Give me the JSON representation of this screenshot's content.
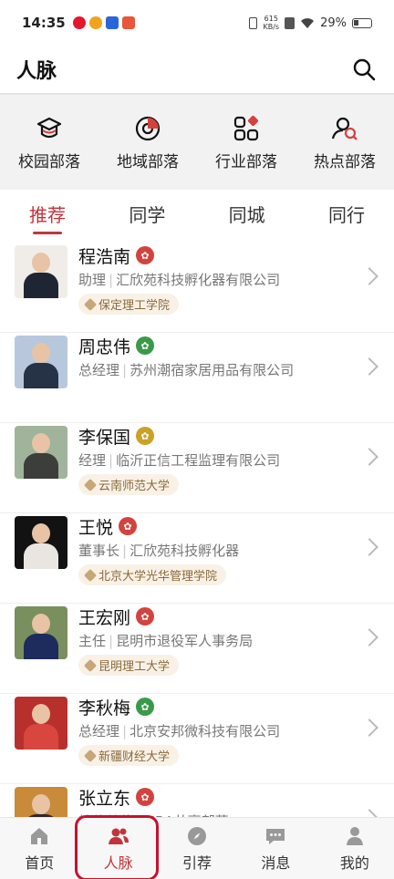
{
  "status_bar": {
    "time": "14:35",
    "net_speed_top": "615",
    "net_speed_bottom": "KB/s",
    "battery": "29%"
  },
  "header": {
    "title": "人脉"
  },
  "tribes": [
    {
      "label": "校园部落",
      "icon": "graduation-cap-icon"
    },
    {
      "label": "地域部落",
      "icon": "target-icon"
    },
    {
      "label": "行业部落",
      "icon": "grid-icon"
    },
    {
      "label": "热点部落",
      "icon": "user-search-icon"
    }
  ],
  "tabs": [
    {
      "label": "推荐",
      "active": true
    },
    {
      "label": "同学",
      "active": false
    },
    {
      "label": "同城",
      "active": false
    },
    {
      "label": "同行",
      "active": false
    }
  ],
  "contacts": [
    {
      "name": "程浩南",
      "badge_color": "#d2433f",
      "title": "助理",
      "company": "汇欣苑科技孵化器有限公司",
      "school": "保定理工学院",
      "avatar_bg": "#f0ede8",
      "suit": "#1f2633"
    },
    {
      "name": "周忠伟",
      "badge_color": "#3a9a4a",
      "title": "总经理",
      "company": "苏州潮宿家居用品有限公司",
      "school": "",
      "avatar_bg": "#b7c8dc",
      "suit": "#263246"
    },
    {
      "name": "李保国",
      "badge_color": "#c9a227",
      "title": "经理",
      "company": "临沂正信工程监理有限公司",
      "school": "云南师范大学",
      "avatar_bg": "#9fb49a",
      "suit": "#3b3e3a"
    },
    {
      "name": "王悦",
      "badge_color": "#d2433f",
      "title": "董事长",
      "company": "汇欣苑科技孵化器",
      "school": "北京大学光华管理学院",
      "avatar_bg": "#121212",
      "suit": "#e9e6e2"
    },
    {
      "name": "王宏刚",
      "badge_color": "#d2433f",
      "title": "主任",
      "company": "昆明市退役军人事务局",
      "school": "昆明理工大学",
      "avatar_bg": "#7a8f5e",
      "suit": "#1d2c5c"
    },
    {
      "name": "李秋梅",
      "badge_color": "#3a9a4a",
      "title": "总经理",
      "company": "北京安邦微科技有限公司",
      "school": "新疆财经大学",
      "avatar_bg": "#b8302c",
      "suit": "#d9463f"
    },
    {
      "name": "张立东",
      "badge_color": "#d2433f",
      "title": "轮值总裁",
      "company": "MBA共享部落",
      "school": "",
      "avatar_bg": "#c98a3a",
      "suit": "#2a2a2a"
    }
  ],
  "bottom_nav": [
    {
      "label": "首页",
      "icon": "home-icon",
      "active": false
    },
    {
      "label": "人脉",
      "icon": "contacts-icon",
      "active": true
    },
    {
      "label": "引荐",
      "icon": "compass-icon",
      "active": false
    },
    {
      "label": "消息",
      "icon": "message-icon",
      "active": false
    },
    {
      "label": "我的",
      "icon": "profile-icon",
      "active": false
    }
  ],
  "colors": {
    "accent": "#c3343a",
    "tag_bg": "#f9f1e6",
    "tag_text": "#8a6a3a"
  }
}
